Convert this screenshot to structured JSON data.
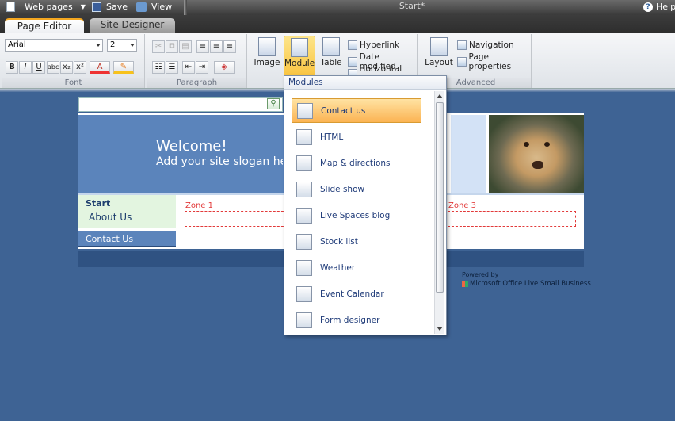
{
  "titlebar": {
    "web_pages": "Web pages",
    "save": "Save",
    "view": "View",
    "doc_title": "Start*",
    "help": "Help"
  },
  "tabs": [
    {
      "label": "Page Editor",
      "active": true
    },
    {
      "label": "Site Designer",
      "active": false
    }
  ],
  "ribbon": {
    "font": {
      "label": "Font",
      "font_name": "Arial",
      "font_size": "2",
      "buttons": [
        "B",
        "I",
        "U",
        "abc",
        "x₂",
        "x²",
        "A",
        "✎"
      ]
    },
    "paragraph": {
      "label": "Paragraph"
    },
    "insert": {
      "image": "Image",
      "module": "Module",
      "table": "Table",
      "hyperlink": "Hyperlink",
      "date_modified": "Date modified",
      "horizontal_line": "Horizontal line"
    },
    "advanced": {
      "label": "Advanced",
      "layout": "Layout",
      "navigation": "Navigation",
      "page_properties": "Page properties"
    }
  },
  "site": {
    "welcome": "Welcome!",
    "slogan": "Add your site slogan here",
    "nav": [
      "Start",
      "About Us",
      "Contact Us"
    ],
    "zones": [
      "Zone 1",
      "Zone 3"
    ],
    "powered_by": "Powered by",
    "powered_product": "Microsoft Office Live Small Business"
  },
  "modules_dropdown": {
    "header": "Modules",
    "items": [
      {
        "label": "Contact us",
        "icon": "contact-form-icon",
        "selected": true
      },
      {
        "label": "HTML",
        "icon": "html-icon",
        "selected": false
      },
      {
        "label": "Map & directions",
        "icon": "map-icon",
        "selected": false
      },
      {
        "label": "Slide show",
        "icon": "slideshow-icon",
        "selected": false
      },
      {
        "label": "Live Spaces blog",
        "icon": "blog-icon",
        "selected": false
      },
      {
        "label": "Stock list",
        "icon": "stock-chart-icon",
        "selected": false
      },
      {
        "label": "Weather",
        "icon": "weather-icon",
        "selected": false
      },
      {
        "label": "Event Calendar",
        "icon": "calendar-icon",
        "selected": false
      },
      {
        "label": "Form designer",
        "icon": "form-designer-icon",
        "selected": false
      }
    ]
  }
}
